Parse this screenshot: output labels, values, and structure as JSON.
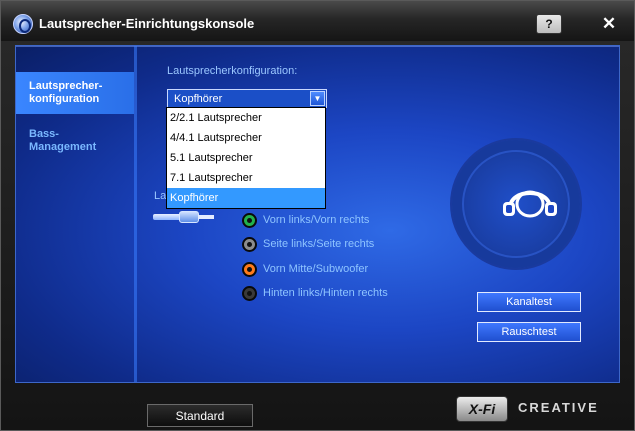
{
  "window": {
    "title": "Lautsprecher-Einrichtungskonsole",
    "help_glyph": "?",
    "close_glyph": "✕"
  },
  "sidebar": {
    "items": [
      {
        "label_line1": "Lautsprecher-",
        "label_line2": "konfiguration",
        "active": true
      },
      {
        "label_line1": "Bass-",
        "label_line2": "Management",
        "active": false
      }
    ]
  },
  "config": {
    "section_label": "Lautsprecherkonfiguration:",
    "selected_value": "Kopfhörer",
    "options": [
      "2/2.1 Lautsprecher",
      "4/4.1 Lautsprecher",
      "5.1 Lautsprecher",
      "7.1 Lautsprecher",
      "Kopfhörer"
    ],
    "selected_index": 4,
    "partial_label": "Lau"
  },
  "ports": [
    {
      "label": "Vorn links/Vorn rechts",
      "color": "#22b14c"
    },
    {
      "label": "Seite links/Seite rechts",
      "color": "#8c8c8c"
    },
    {
      "label": "Vorn Mitte/Subwoofer",
      "color": "#ff7a1a"
    },
    {
      "label": "Hinten links/Hinten rechts",
      "color": "#3a3a3a"
    }
  ],
  "buttons": {
    "channel_test": "Kanaltest",
    "noise_test": "Rauschtest",
    "standard": "Standard"
  },
  "branding": {
    "xfi": "X-Fi",
    "creative": "CREATIVE"
  },
  "colors": {
    "accent": "#2a6fe8",
    "panel": "#1c46c4",
    "selection": "#3399ff"
  }
}
